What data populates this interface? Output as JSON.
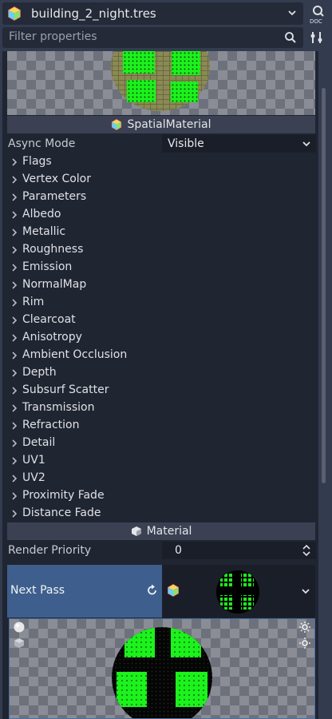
{
  "resource": {
    "title": "building_2_night.tres",
    "icon": "material-cube-icon"
  },
  "filter": {
    "placeholder": "Filter properties"
  },
  "spatial_header": "SpatialMaterial",
  "async_mode": {
    "label": "Async Mode",
    "value": "Visible"
  },
  "groups": [
    "Flags",
    "Vertex Color",
    "Parameters",
    "Albedo",
    "Metallic",
    "Roughness",
    "Emission",
    "NormalMap",
    "Rim",
    "Clearcoat",
    "Anisotropy",
    "Ambient Occlusion",
    "Depth",
    "Subsurf Scatter",
    "Transmission",
    "Refraction",
    "Detail",
    "UV1",
    "UV2",
    "Proximity Fade",
    "Distance Fade"
  ],
  "material_header": "Material",
  "render_priority": {
    "label": "Render Priority",
    "value": "0"
  },
  "next_pass": {
    "label": "Next Pass"
  },
  "colors": {
    "accent": "#3e5f8d",
    "panel": "#202532",
    "header": "#3b4152",
    "sphere_green": "#1cf21c"
  }
}
